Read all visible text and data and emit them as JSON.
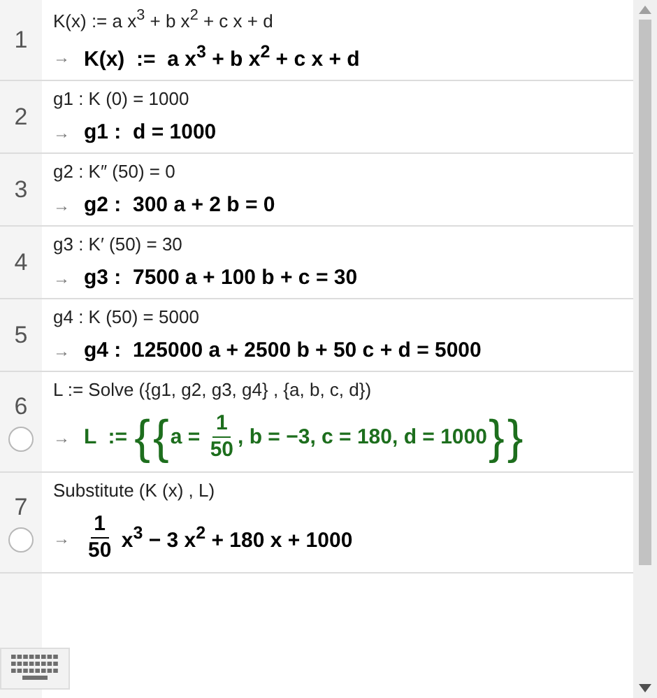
{
  "rows": [
    {
      "number": "1",
      "input": "K(x) := a x$^{3}$ + b x$^{2}$ + c x + d",
      "arrow": "→",
      "toggle": false,
      "output": {
        "color": "#000000",
        "parts": [
          {
            "kind": "text",
            "text": "K(x)  :=  a x$^{3}$ + b x$^{2}$ + c x + d"
          }
        ]
      }
    },
    {
      "number": "2",
      "input": "g1 : K (0) = 1000",
      "arrow": "→",
      "toggle": false,
      "output": {
        "color": "#000000",
        "parts": [
          {
            "kind": "text",
            "text": "g1 :  d = 1000"
          }
        ]
      }
    },
    {
      "number": "3",
      "input": "g2 : K″ (50) = 0",
      "arrow": "→",
      "toggle": false,
      "output": {
        "color": "#000000",
        "parts": [
          {
            "kind": "text",
            "text": "g2 :  300 a + 2 b = 0"
          }
        ]
      }
    },
    {
      "number": "4",
      "input": "g3 : K′ (50) = 30",
      "arrow": "→",
      "toggle": false,
      "output": {
        "color": "#000000",
        "parts": [
          {
            "kind": "text",
            "text": "g3 :  7500 a + 100 b + c = 30"
          }
        ]
      }
    },
    {
      "number": "5",
      "input": "g4 : K (50) = 5000",
      "arrow": "→",
      "toggle": false,
      "output": {
        "color": "#000000",
        "parts": [
          {
            "kind": "text",
            "text": "g4 :  125000 a + 2500 b + 50 c + d = 5000"
          }
        ]
      }
    },
    {
      "number": "6",
      "input": "L := Solve ({g1, g2, g3, g4} , {a, b, c, d})",
      "arrow": "→",
      "toggle": true,
      "output": {
        "color": "#1d6e1d",
        "parts": [
          {
            "kind": "text",
            "text": "L  := "
          },
          {
            "kind": "brace",
            "text": "{"
          },
          {
            "kind": "brace",
            "text": "{"
          },
          {
            "kind": "text",
            "text": "a = "
          },
          {
            "kind": "frac",
            "num": "1",
            "den": "50"
          },
          {
            "kind": "text",
            "text": ", b = −3, c = 180, d = 1000"
          },
          {
            "kind": "brace",
            "text": "}"
          },
          {
            "kind": "brace",
            "text": "}"
          }
        ]
      }
    },
    {
      "number": "7",
      "input": "Substitute (K (x) , L)",
      "arrow": "→",
      "toggle": true,
      "output": {
        "color": "#000000",
        "parts": [
          {
            "kind": "frac",
            "num": "1",
            "den": "50"
          },
          {
            "kind": "text",
            "text": " x$^{3}$ − 3 x$^{2}$ + 180 x + 1000"
          }
        ]
      }
    }
  ]
}
